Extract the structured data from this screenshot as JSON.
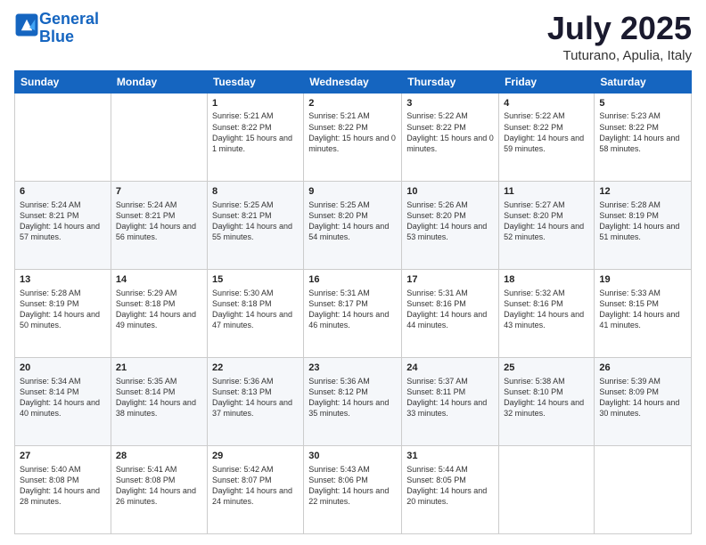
{
  "logo": {
    "line1": "General",
    "line2": "Blue"
  },
  "title": "July 2025",
  "location": "Tuturano, Apulia, Italy",
  "weekdays": [
    "Sunday",
    "Monday",
    "Tuesday",
    "Wednesday",
    "Thursday",
    "Friday",
    "Saturday"
  ],
  "weeks": [
    [
      {
        "day": "",
        "info": ""
      },
      {
        "day": "",
        "info": ""
      },
      {
        "day": "1",
        "info": "Sunrise: 5:21 AM\nSunset: 8:22 PM\nDaylight: 15 hours and 1 minute."
      },
      {
        "day": "2",
        "info": "Sunrise: 5:21 AM\nSunset: 8:22 PM\nDaylight: 15 hours and 0 minutes."
      },
      {
        "day": "3",
        "info": "Sunrise: 5:22 AM\nSunset: 8:22 PM\nDaylight: 15 hours and 0 minutes."
      },
      {
        "day": "4",
        "info": "Sunrise: 5:22 AM\nSunset: 8:22 PM\nDaylight: 14 hours and 59 minutes."
      },
      {
        "day": "5",
        "info": "Sunrise: 5:23 AM\nSunset: 8:22 PM\nDaylight: 14 hours and 58 minutes."
      }
    ],
    [
      {
        "day": "6",
        "info": "Sunrise: 5:24 AM\nSunset: 8:21 PM\nDaylight: 14 hours and 57 minutes."
      },
      {
        "day": "7",
        "info": "Sunrise: 5:24 AM\nSunset: 8:21 PM\nDaylight: 14 hours and 56 minutes."
      },
      {
        "day": "8",
        "info": "Sunrise: 5:25 AM\nSunset: 8:21 PM\nDaylight: 14 hours and 55 minutes."
      },
      {
        "day": "9",
        "info": "Sunrise: 5:25 AM\nSunset: 8:20 PM\nDaylight: 14 hours and 54 minutes."
      },
      {
        "day": "10",
        "info": "Sunrise: 5:26 AM\nSunset: 8:20 PM\nDaylight: 14 hours and 53 minutes."
      },
      {
        "day": "11",
        "info": "Sunrise: 5:27 AM\nSunset: 8:20 PM\nDaylight: 14 hours and 52 minutes."
      },
      {
        "day": "12",
        "info": "Sunrise: 5:28 AM\nSunset: 8:19 PM\nDaylight: 14 hours and 51 minutes."
      }
    ],
    [
      {
        "day": "13",
        "info": "Sunrise: 5:28 AM\nSunset: 8:19 PM\nDaylight: 14 hours and 50 minutes."
      },
      {
        "day": "14",
        "info": "Sunrise: 5:29 AM\nSunset: 8:18 PM\nDaylight: 14 hours and 49 minutes."
      },
      {
        "day": "15",
        "info": "Sunrise: 5:30 AM\nSunset: 8:18 PM\nDaylight: 14 hours and 47 minutes."
      },
      {
        "day": "16",
        "info": "Sunrise: 5:31 AM\nSunset: 8:17 PM\nDaylight: 14 hours and 46 minutes."
      },
      {
        "day": "17",
        "info": "Sunrise: 5:31 AM\nSunset: 8:16 PM\nDaylight: 14 hours and 44 minutes."
      },
      {
        "day": "18",
        "info": "Sunrise: 5:32 AM\nSunset: 8:16 PM\nDaylight: 14 hours and 43 minutes."
      },
      {
        "day": "19",
        "info": "Sunrise: 5:33 AM\nSunset: 8:15 PM\nDaylight: 14 hours and 41 minutes."
      }
    ],
    [
      {
        "day": "20",
        "info": "Sunrise: 5:34 AM\nSunset: 8:14 PM\nDaylight: 14 hours and 40 minutes."
      },
      {
        "day": "21",
        "info": "Sunrise: 5:35 AM\nSunset: 8:14 PM\nDaylight: 14 hours and 38 minutes."
      },
      {
        "day": "22",
        "info": "Sunrise: 5:36 AM\nSunset: 8:13 PM\nDaylight: 14 hours and 37 minutes."
      },
      {
        "day": "23",
        "info": "Sunrise: 5:36 AM\nSunset: 8:12 PM\nDaylight: 14 hours and 35 minutes."
      },
      {
        "day": "24",
        "info": "Sunrise: 5:37 AM\nSunset: 8:11 PM\nDaylight: 14 hours and 33 minutes."
      },
      {
        "day": "25",
        "info": "Sunrise: 5:38 AM\nSunset: 8:10 PM\nDaylight: 14 hours and 32 minutes."
      },
      {
        "day": "26",
        "info": "Sunrise: 5:39 AM\nSunset: 8:09 PM\nDaylight: 14 hours and 30 minutes."
      }
    ],
    [
      {
        "day": "27",
        "info": "Sunrise: 5:40 AM\nSunset: 8:08 PM\nDaylight: 14 hours and 28 minutes."
      },
      {
        "day": "28",
        "info": "Sunrise: 5:41 AM\nSunset: 8:08 PM\nDaylight: 14 hours and 26 minutes."
      },
      {
        "day": "29",
        "info": "Sunrise: 5:42 AM\nSunset: 8:07 PM\nDaylight: 14 hours and 24 minutes."
      },
      {
        "day": "30",
        "info": "Sunrise: 5:43 AM\nSunset: 8:06 PM\nDaylight: 14 hours and 22 minutes."
      },
      {
        "day": "31",
        "info": "Sunrise: 5:44 AM\nSunset: 8:05 PM\nDaylight: 14 hours and 20 minutes."
      },
      {
        "day": "",
        "info": ""
      },
      {
        "day": "",
        "info": ""
      }
    ]
  ]
}
